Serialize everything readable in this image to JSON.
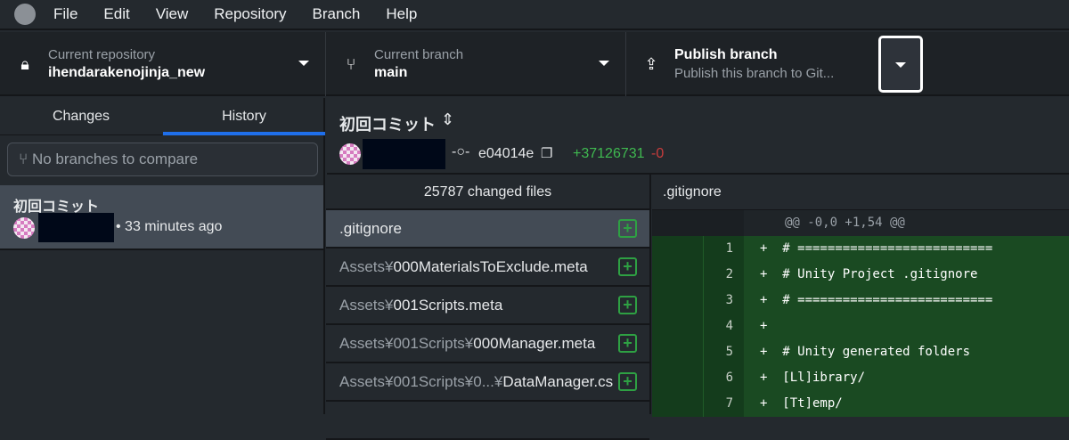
{
  "menu": [
    "File",
    "Edit",
    "View",
    "Repository",
    "Branch",
    "Help"
  ],
  "toolbar": {
    "repo": {
      "label": "Current repository",
      "value": "ihendarakenojinja_new"
    },
    "branch": {
      "label": "Current branch",
      "value": "main"
    },
    "publish": {
      "label": "Publish branch",
      "desc": "Publish this branch to Git..."
    }
  },
  "tabs": [
    "Changes",
    "History"
  ],
  "filter": {
    "placeholder": "No branches to compare"
  },
  "history": [
    {
      "title": "初回コミット",
      "time": "• 33 minutes ago"
    }
  ],
  "commit": {
    "title": "初回コミット",
    "sha": "e04014e",
    "additions": "+37126731",
    "deletions": "-0"
  },
  "files": {
    "header": "25787 changed files",
    "items": [
      {
        "dir": "",
        "name": ".gitignore"
      },
      {
        "dir": "Assets¥",
        "name": "000MaterialsToExclude.meta"
      },
      {
        "dir": "Assets¥",
        "name": "001Scripts.meta"
      },
      {
        "dir": "Assets¥001Scripts¥",
        "name": "000Manager.meta"
      },
      {
        "dir": "Assets¥001Scripts¥0...¥",
        "name": "DataManager.cs"
      }
    ]
  },
  "diff": {
    "file": ".gitignore",
    "hunk": "@@ -0,0 +1,54 @@",
    "lines": [
      {
        "n": "1",
        "text": "+  # =========================="
      },
      {
        "n": "2",
        "text": "+  # Unity Project .gitignore"
      },
      {
        "n": "3",
        "text": "+  # =========================="
      },
      {
        "n": "4",
        "text": "+"
      },
      {
        "n": "5",
        "text": "+  # Unity generated folders"
      },
      {
        "n": "6",
        "text": "+  [Ll]ibrary/"
      },
      {
        "n": "7",
        "text": "+  [Tt]emp/"
      }
    ]
  }
}
